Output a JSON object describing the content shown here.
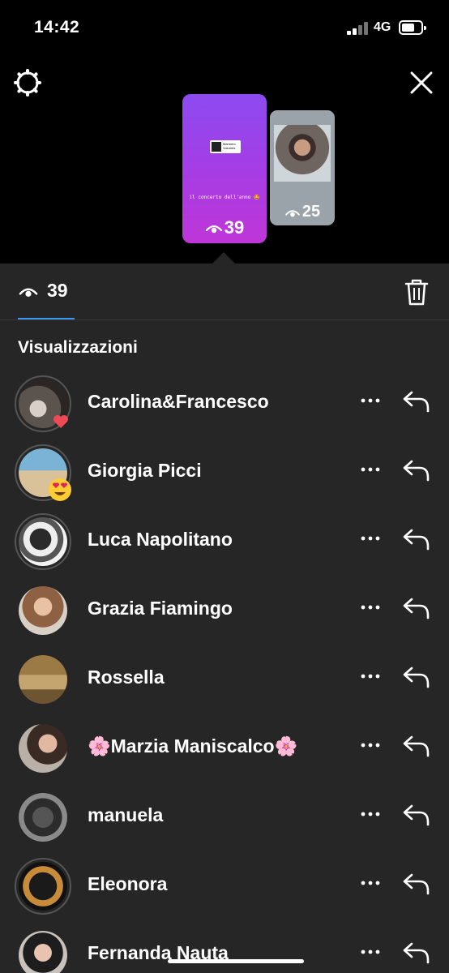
{
  "status_bar": {
    "time": "14:42",
    "network": "4G"
  },
  "preview": {
    "main_sticker_text": "Marinero\nVolumes",
    "main_caption": "il concerto dell'anno 🤩",
    "main_views": "39",
    "second_views": "25"
  },
  "header": {
    "total_views": "39"
  },
  "section_title": "Visualizzazioni",
  "viewers": [
    {
      "name": "Carolina&Francesco",
      "reaction": "heart-icon"
    },
    {
      "name": "Giorgia Picci",
      "reaction": "heart-eyes-emoji"
    },
    {
      "name": "Luca Napolitano"
    },
    {
      "name": "Grazia Fiamingo"
    },
    {
      "name": "Rossella"
    },
    {
      "name": "🌸Marzia Maniscalco🌸"
    },
    {
      "name": "manuela"
    },
    {
      "name": "Eleonora"
    },
    {
      "name": "Fernanda Nauta"
    }
  ],
  "colors": {
    "background": "#000000",
    "sheet": "#262626",
    "accent": "#3897f0",
    "reaction_red": "#ed4956"
  }
}
